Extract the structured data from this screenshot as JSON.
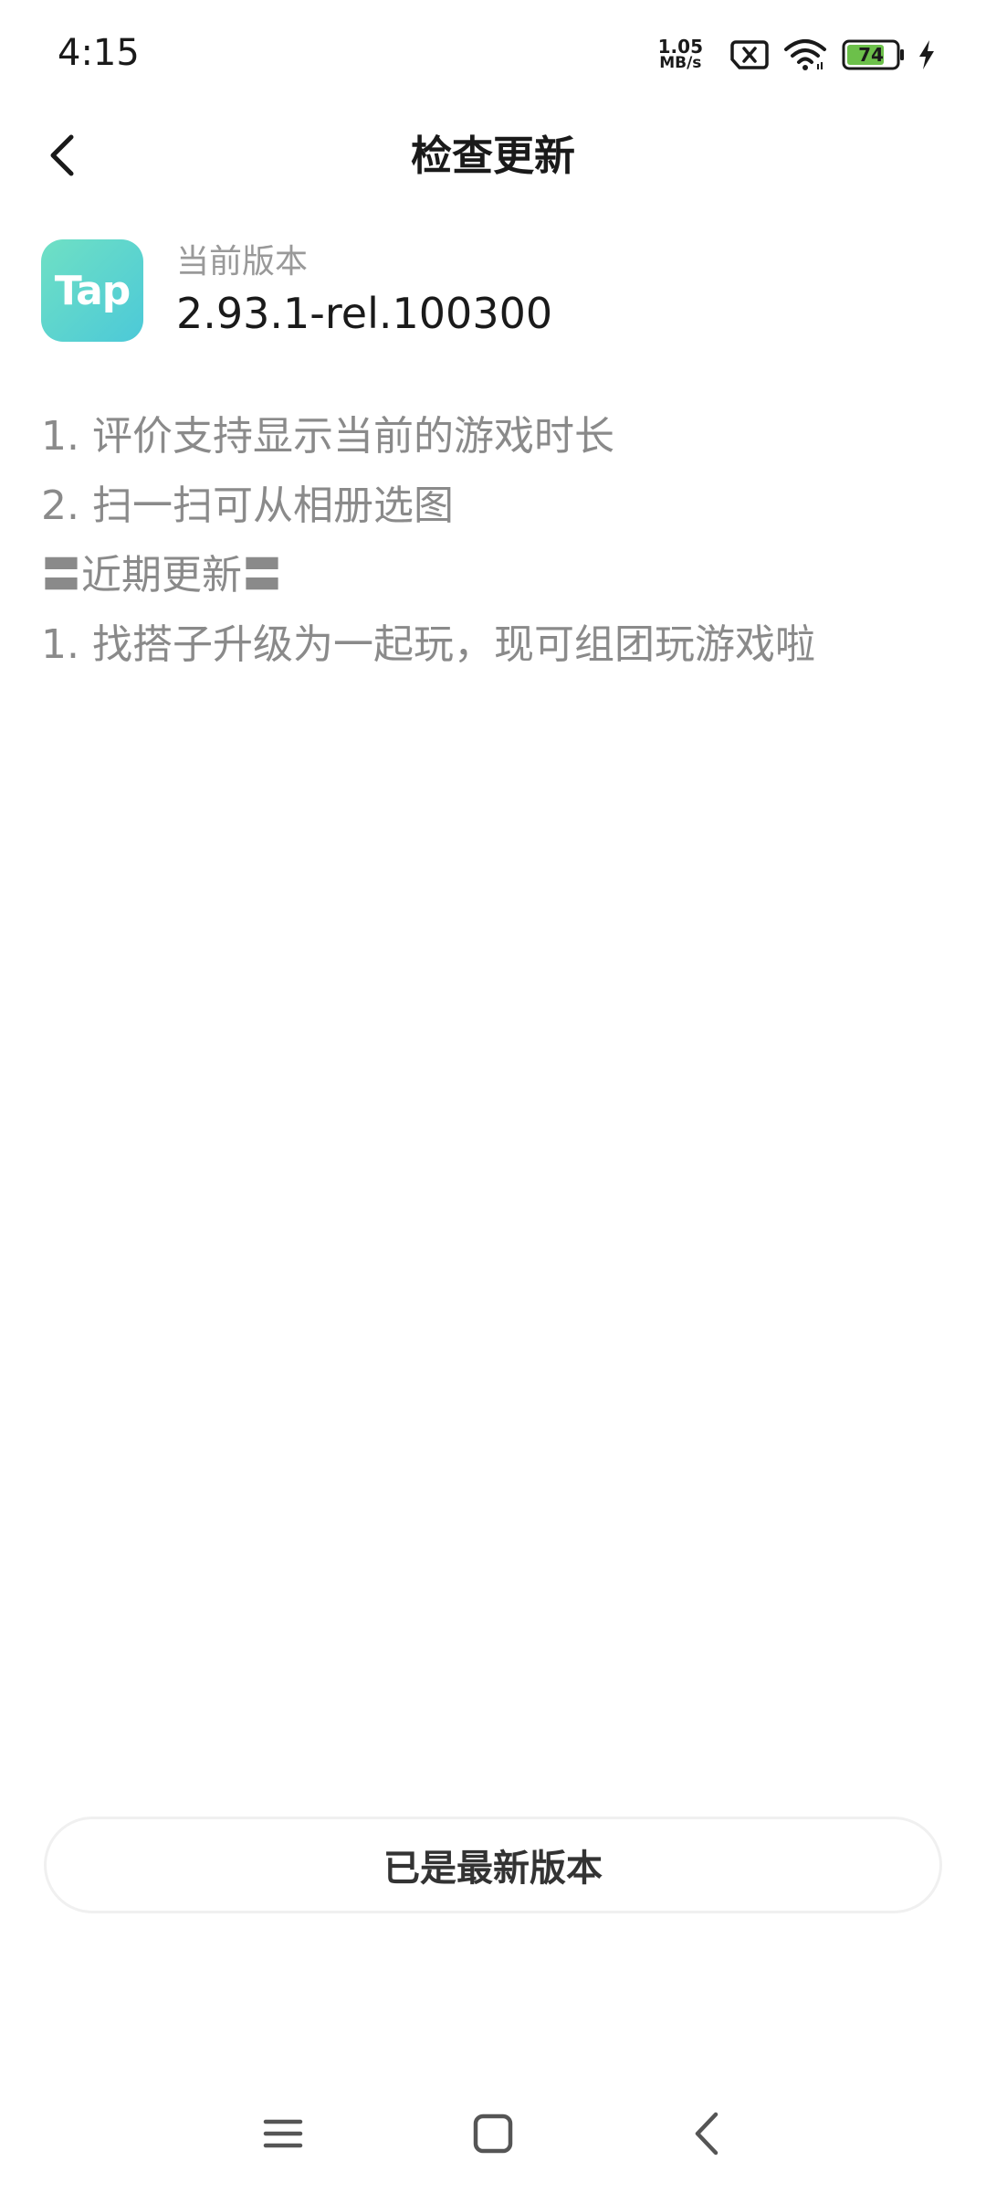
{
  "status_bar": {
    "time": "4:15",
    "net_speed_value": "1.05",
    "net_speed_unit": "MB/s",
    "battery_level": "74",
    "icons": [
      "sim-error-icon",
      "wifi-icon",
      "battery-icon",
      "charging-icon"
    ],
    "battery_color": "#6cc04a"
  },
  "header": {
    "title": "检查更新",
    "back_icon": "chevron-left-icon"
  },
  "app_info": {
    "icon_text": "Tap",
    "icon_colors": [
      "#6fe0c4",
      "#4cc9d8"
    ],
    "version_label": "当前版本",
    "version_value": "2.93.1-rel.100300"
  },
  "changelog": [
    "1. 评价支持显示当前的游戏时长",
    "2. 扫一扫可从相册选图",
    "〓近期更新〓",
    "1. 找搭子升级为一起玩，现可组团玩游戏啦"
  ],
  "latest_button": {
    "label": "已是最新版本"
  },
  "nav_bar": {
    "icons": [
      "menu-icon",
      "home-icon",
      "back-icon"
    ]
  }
}
